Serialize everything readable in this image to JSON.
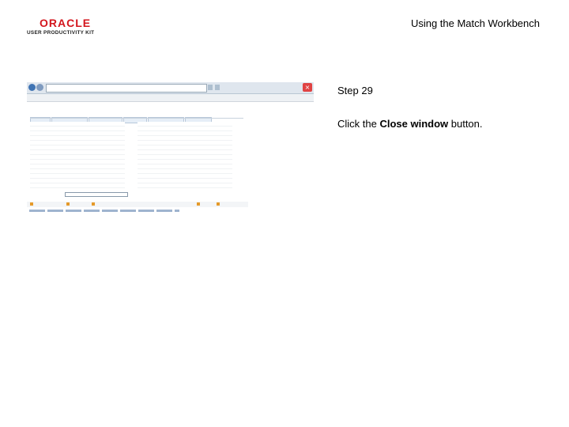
{
  "header": {
    "logo_text": "ORACLE",
    "logo_subtext": "USER PRODUCTIVITY KIT",
    "title": "Using the Match Workbench"
  },
  "step": {
    "label": "Step 29"
  },
  "instruction": {
    "prefix": "Click the ",
    "target": "Close window",
    "suffix": " button."
  }
}
